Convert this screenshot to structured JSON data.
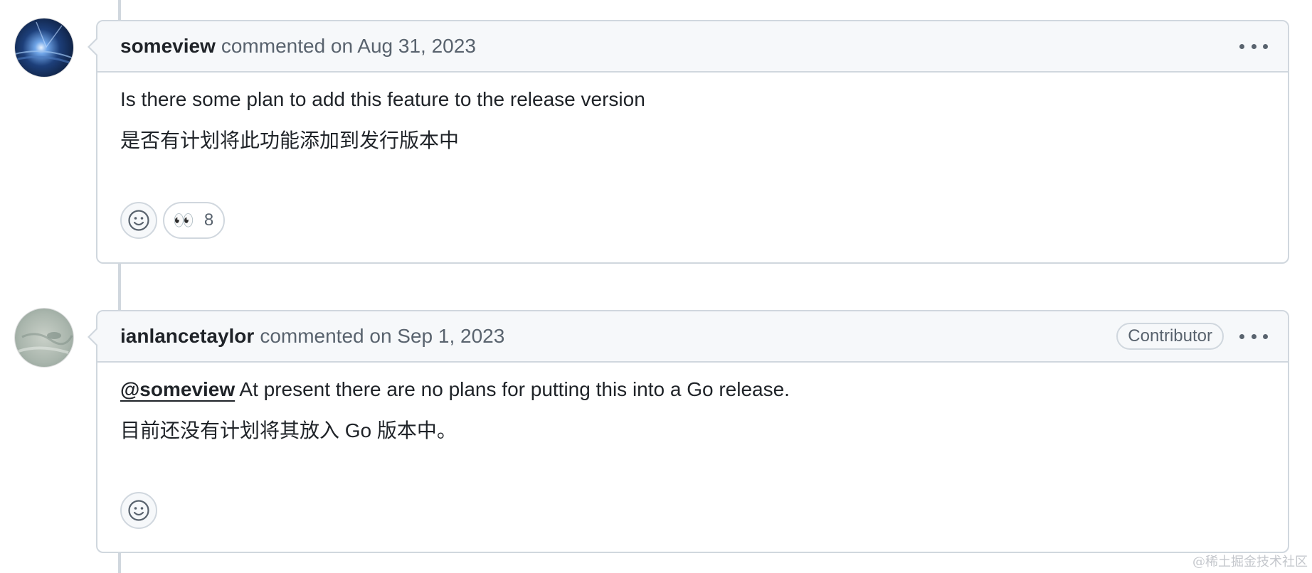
{
  "comments": [
    {
      "author": "someview",
      "meta": "commented on Aug 31, 2023",
      "badge": "",
      "body_en": "Is there some plan to add this feature to the release version",
      "body_zh": "是否有计划将此功能添加到发行版本中",
      "reactions": [
        {
          "emoji": "👀",
          "count": "8"
        }
      ],
      "menu_icon": "kebab-horizontal-icon",
      "add_reaction_icon": "smiley-icon"
    },
    {
      "author": "ianlancetaylor",
      "meta": "commented on Sep 1, 2023",
      "badge": "Contributor",
      "mention": "@someview",
      "body_en": "At present there are no plans for putting this into a Go release.",
      "body_zh": "目前还没有计划将其放入 Go 版本中。",
      "reactions": [],
      "menu_icon": "kebab-horizontal-icon",
      "add_reaction_icon": "smiley-icon"
    }
  ],
  "watermark": "@稀土掘金技术社区",
  "colors": {
    "border": "#d0d7de",
    "header_bg": "#f6f8fa",
    "text": "#1f2328",
    "muted": "#59636e"
  }
}
